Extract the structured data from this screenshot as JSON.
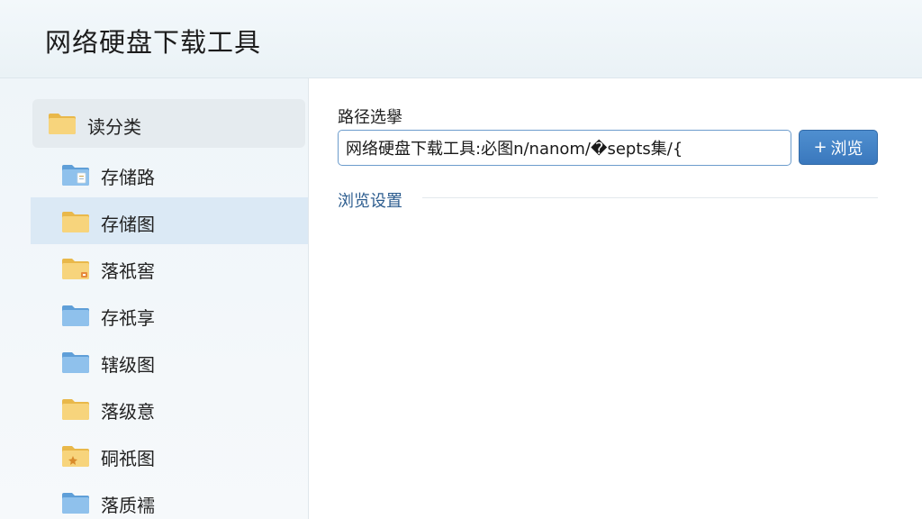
{
  "header": {
    "title": "网络硬盘下载工具"
  },
  "sidebar": {
    "root": {
      "label": "读分类",
      "icon": "folder-icon"
    },
    "items": [
      {
        "label": "存储路",
        "icon": "folder-blue-doc-icon",
        "color": "blue",
        "selected": false
      },
      {
        "label": "存储图",
        "icon": "folder-icon",
        "color": "yellow",
        "selected": true
      },
      {
        "label": "落祇窖",
        "icon": "folder-badge-icon",
        "color": "yellow",
        "selected": false
      },
      {
        "label": "存祇享",
        "icon": "folder-blue-icon",
        "color": "blue",
        "selected": false
      },
      {
        "label": "辖级图",
        "icon": "folder-blue-icon",
        "color": "blue",
        "selected": false
      },
      {
        "label": "落级意",
        "icon": "folder-icon",
        "color": "yellow",
        "selected": false
      },
      {
        "label": "硐祇图",
        "icon": "folder-star-icon",
        "color": "yellow",
        "selected": false
      },
      {
        "label": "落质襦",
        "icon": "folder-blue-icon",
        "color": "blue",
        "selected": false
      }
    ]
  },
  "main": {
    "path_label": "路径选擧",
    "path_value": "网络硬盘下载工具:必图n/nanom/�septs集/{",
    "browse_label": "浏览",
    "section_title": "浏览设置"
  },
  "colors": {
    "accent": "#3a78bd",
    "selected_bg": "#dbe9f5",
    "section_title": "#2d5d8f",
    "folder_yellow": "#f5cd6b",
    "folder_blue": "#7fb6e6"
  }
}
